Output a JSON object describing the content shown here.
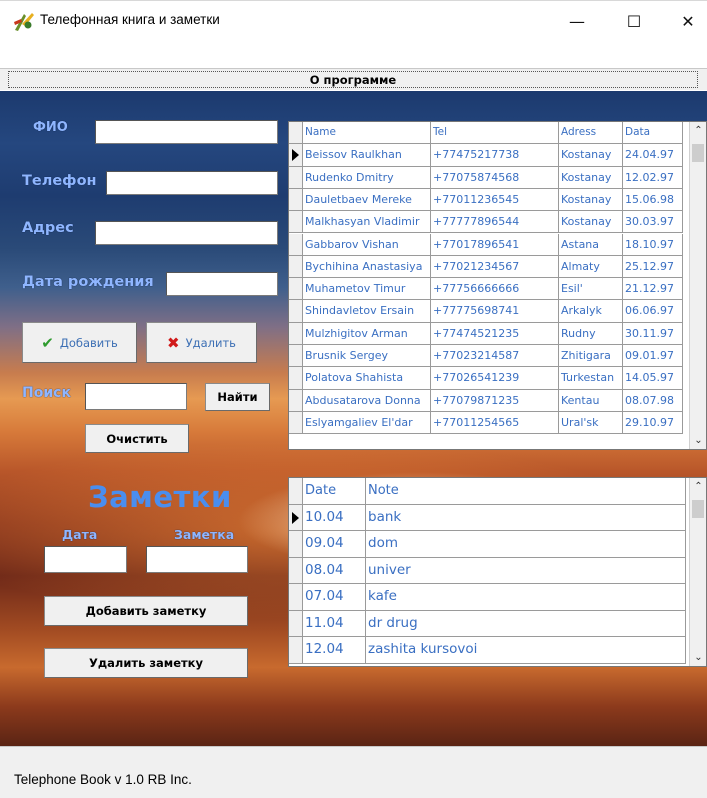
{
  "window": {
    "title": "Телефонная книга и заметки",
    "minimize_glyph": "—",
    "maximize_glyph": "☐",
    "close_glyph": "✕"
  },
  "menu": {
    "about_label": "О программе"
  },
  "form": {
    "fio_label": "ФИО",
    "phone_label": "Телефон",
    "address_label": "Адрес",
    "birthdate_label": "Дата рождения",
    "fio_value": "",
    "phone_value": "",
    "address_value": "",
    "birthdate_value": "",
    "add_label": "Добавить",
    "delete_label": "Удалить",
    "search_label": "Поиск",
    "search_value": "",
    "find_label": "Найти",
    "clear_label": "Очистить"
  },
  "notes_panel": {
    "title": "Заметки",
    "date_label": "Дата",
    "note_label": "Заметка",
    "date_value": "",
    "note_value": "",
    "add_note_label": "Добавить заметку",
    "delete_note_label": "Удалить заметку"
  },
  "contacts_grid": {
    "columns": [
      "Name",
      "Tel",
      "Adress",
      "Data"
    ],
    "rows": [
      [
        "Beissov Raulkhan",
        "+77475217738",
        "Kostanay",
        "24.04.97"
      ],
      [
        "Rudenko Dmitry",
        "+77075874568",
        "Kostanay",
        "12.02.97"
      ],
      [
        "Dauletbaev Mereke",
        "+77011236545",
        "Kostanay",
        "15.06.98"
      ],
      [
        "Malkhasyan Vladimir",
        "+77777896544",
        "Kostanay",
        "30.03.97"
      ],
      [
        "Gabbarov Vishan",
        "+77017896541",
        "Astana",
        "18.10.97"
      ],
      [
        "Bychihina Anastasiya",
        "+77021234567",
        "Almaty",
        "25.12.97"
      ],
      [
        "Muhametov Timur",
        "+77756666666",
        "Esil'",
        "21.12.97"
      ],
      [
        "Shindavletov Ersain",
        "+77775698741",
        "Arkalyk",
        "06.06.97"
      ],
      [
        "Mulzhigitov Arman",
        "+77474521235",
        "Rudny",
        "30.11.97"
      ],
      [
        "Brusnik Sergey",
        "+77023214587",
        "Zhitigara",
        "09.01.97"
      ],
      [
        "Polatova Shahista",
        "+77026541239",
        "Turkestan",
        "14.05.97"
      ],
      [
        "Abdusatarova Donna",
        "+77079871235",
        "Kentau",
        "08.07.98"
      ],
      [
        "Eslyamgaliev El'dar",
        "+77011254565",
        "Ural'sk",
        "29.10.97"
      ]
    ],
    "selected_row": 0
  },
  "notes_grid": {
    "columns": [
      "Date",
      "Note"
    ],
    "rows": [
      [
        "10.04",
        "bank"
      ],
      [
        "09.04",
        "dom"
      ],
      [
        "08.04",
        "univer"
      ],
      [
        "07.04",
        "kafe"
      ],
      [
        "11.04",
        "dr drug"
      ],
      [
        "12.04",
        "zashita kursovoi"
      ]
    ],
    "selected_row": 0
  },
  "status": {
    "text": "Telephone Book   v 1.0  RB Inc."
  },
  "colors": {
    "label_blue": "#8fb6ff",
    "notes_title_blue": "#4a8eef",
    "grid_text_blue": "#3a6fc2",
    "check_green": "#2e9b2e",
    "cross_red": "#d11a1a"
  }
}
